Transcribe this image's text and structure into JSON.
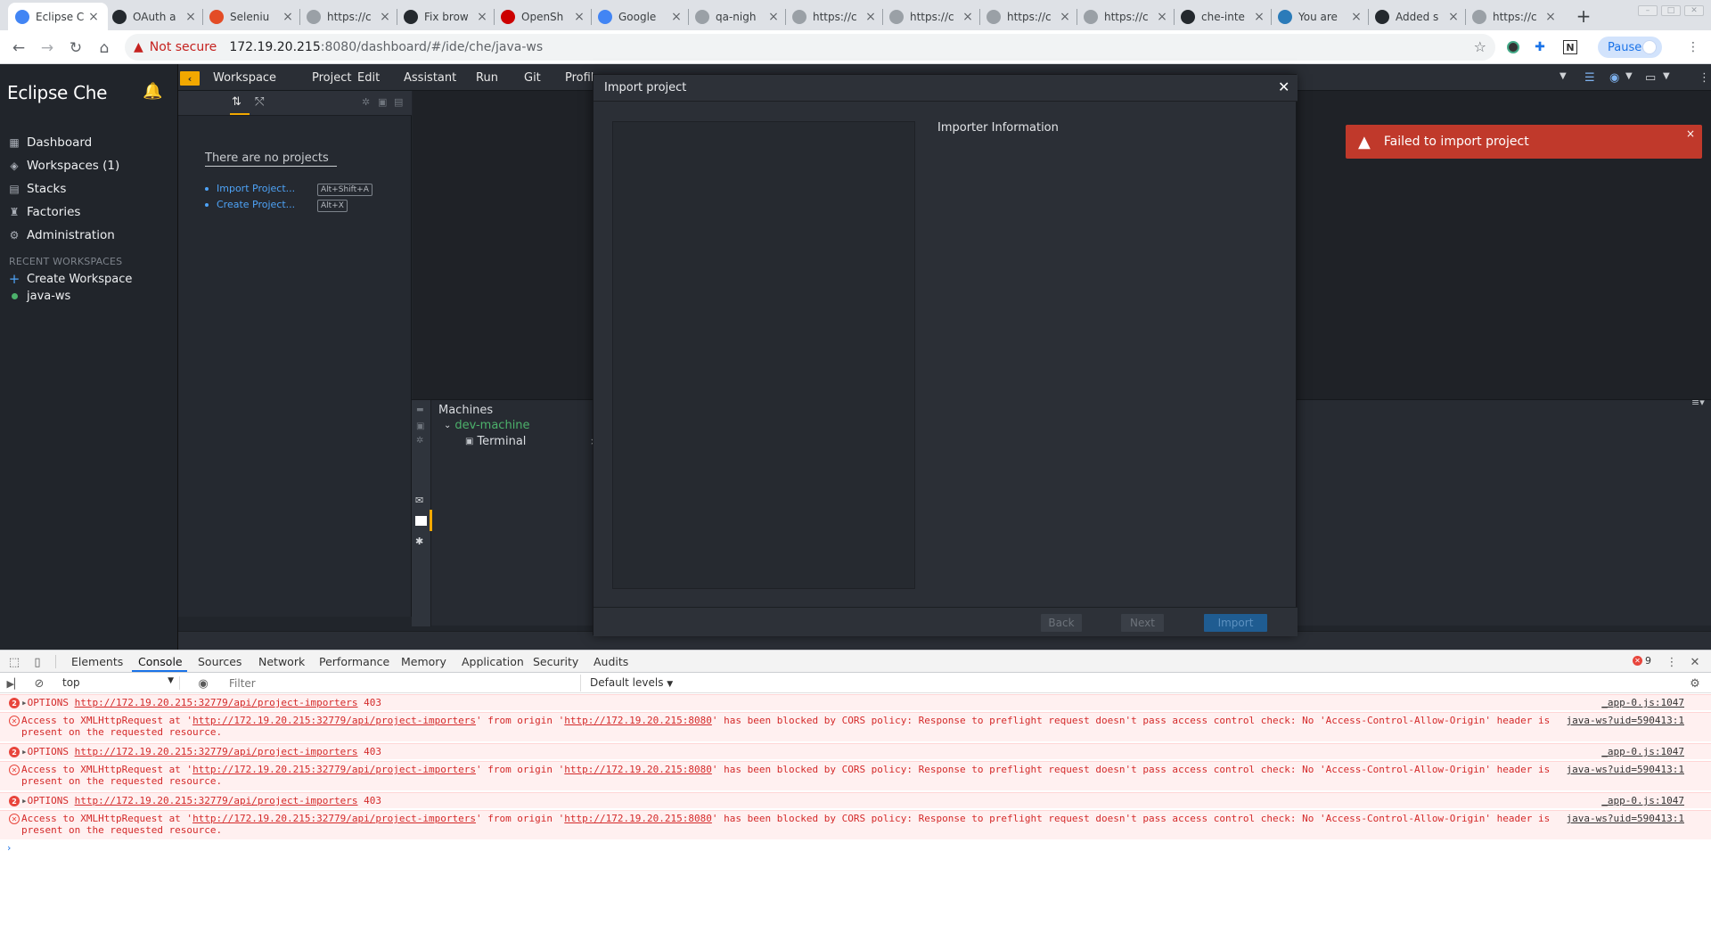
{
  "browser": {
    "tabs": [
      {
        "title": "Eclipse C",
        "active": true
      },
      {
        "title": "OAuth a"
      },
      {
        "title": "Seleniu"
      },
      {
        "title": "https://c"
      },
      {
        "title": "Fix brow"
      },
      {
        "title": "OpenSh"
      },
      {
        "title": "Google"
      },
      {
        "title": "qa-nigh"
      },
      {
        "title": "https://c"
      },
      {
        "title": "https://c"
      },
      {
        "title": "https://c"
      },
      {
        "title": "https://c"
      },
      {
        "title": "che-inte"
      },
      {
        "title": "You are"
      },
      {
        "title": "Added s"
      },
      {
        "title": "https://c"
      }
    ],
    "address": {
      "security_label": "Not secure",
      "host": "172.19.20.215",
      "path": ":8080/dashboard/#/ide/che/java-ws"
    },
    "profile_label": "Paused"
  },
  "dashboard": {
    "brand": "Eclipse Che",
    "nav": [
      {
        "label": "Dashboard",
        "icon": "grid-icon"
      },
      {
        "label": "Workspaces (1)",
        "icon": "cubes-icon"
      },
      {
        "label": "Stacks",
        "icon": "stack-icon"
      },
      {
        "label": "Factories",
        "icon": "factory-icon"
      },
      {
        "label": "Administration",
        "icon": "gear-icon"
      }
    ],
    "recent_title": "RECENT WORKSPACES",
    "recent": [
      {
        "label": "Create Workspace",
        "icon": "plus-icon"
      },
      {
        "label": "java-ws",
        "icon": "status-dot-icon"
      }
    ]
  },
  "ide": {
    "menu": [
      "Workspace",
      "Project",
      "Edit",
      "Assistant",
      "Run",
      "Git",
      "Profil"
    ],
    "explorer": {
      "empty_title": "There are no projects",
      "links": [
        {
          "label": "Import Project...",
          "shortcut": "Alt+Shift+A"
        },
        {
          "label": "Create Project...",
          "shortcut": "Alt+X"
        }
      ]
    },
    "machines": {
      "title": "Machines",
      "machine": "dev-machine",
      "terminal": "Terminal"
    },
    "notification": "Failed to import project"
  },
  "modal": {
    "title": "Import project",
    "importer_info": "Importer Information",
    "buttons": {
      "back": "Back",
      "next": "Next",
      "import": "Import"
    }
  },
  "devtools": {
    "tabs": [
      "Elements",
      "Console",
      "Sources",
      "Network",
      "Performance",
      "Memory",
      "Application",
      "Security",
      "Audits"
    ],
    "active_tab": "Console",
    "error_count": "9",
    "context": "top",
    "filter_placeholder": "Filter",
    "levels": "Default levels",
    "rows": [
      {
        "type": "count",
        "count": "2",
        "pre": "OPTIONS ",
        "url": "http://172.19.20.215:32779/api/project-importers",
        "post": " 403",
        "src": "_app-0.js:1047"
      },
      {
        "type": "cors",
        "pre": "Access to XMLHttpRequest at '",
        "url": "http://172.19.20.215:32779/api/project-importers",
        "mid": "' from origin '",
        "origin": "http://172.19.20.215:8080",
        "post": "' has been blocked by CORS policy: Response to preflight request doesn't pass access control check: No 'Access-Control-Allow-Origin' header is\npresent on the requested resource.",
        "src": "java-ws?uid=590413:1"
      },
      {
        "type": "count",
        "count": "2",
        "pre": "OPTIONS ",
        "url": "http://172.19.20.215:32779/api/project-importers",
        "post": " 403",
        "src": "_app-0.js:1047"
      },
      {
        "type": "cors",
        "pre": "Access to XMLHttpRequest at '",
        "url": "http://172.19.20.215:32779/api/project-importers",
        "mid": "' from origin '",
        "origin": "http://172.19.20.215:8080",
        "post": "' has been blocked by CORS policy: Response to preflight request doesn't pass access control check: No 'Access-Control-Allow-Origin' header is\npresent on the requested resource.",
        "src": "java-ws?uid=590413:1"
      },
      {
        "type": "count",
        "count": "2",
        "pre": "OPTIONS ",
        "url": "http://172.19.20.215:32779/api/project-importers",
        "post": " 403",
        "src": "_app-0.js:1047"
      },
      {
        "type": "cors",
        "pre": "Access to XMLHttpRequest at '",
        "url": "http://172.19.20.215:32779/api/project-importers",
        "mid": "' from origin '",
        "origin": "http://172.19.20.215:8080",
        "post": "' has been blocked by CORS policy: Response to preflight request doesn't pass access control check: No 'Access-Control-Allow-Origin' header is\npresent on the requested resource.",
        "src": "java-ws?uid=590413:1"
      }
    ]
  },
  "colors": {
    "che_sidebar": "#21252b",
    "che_accent": "#f2a800",
    "notification_error": "#c0392b",
    "console_error_bg": "#fff0f0",
    "console_error_text": "#d42a2a"
  }
}
